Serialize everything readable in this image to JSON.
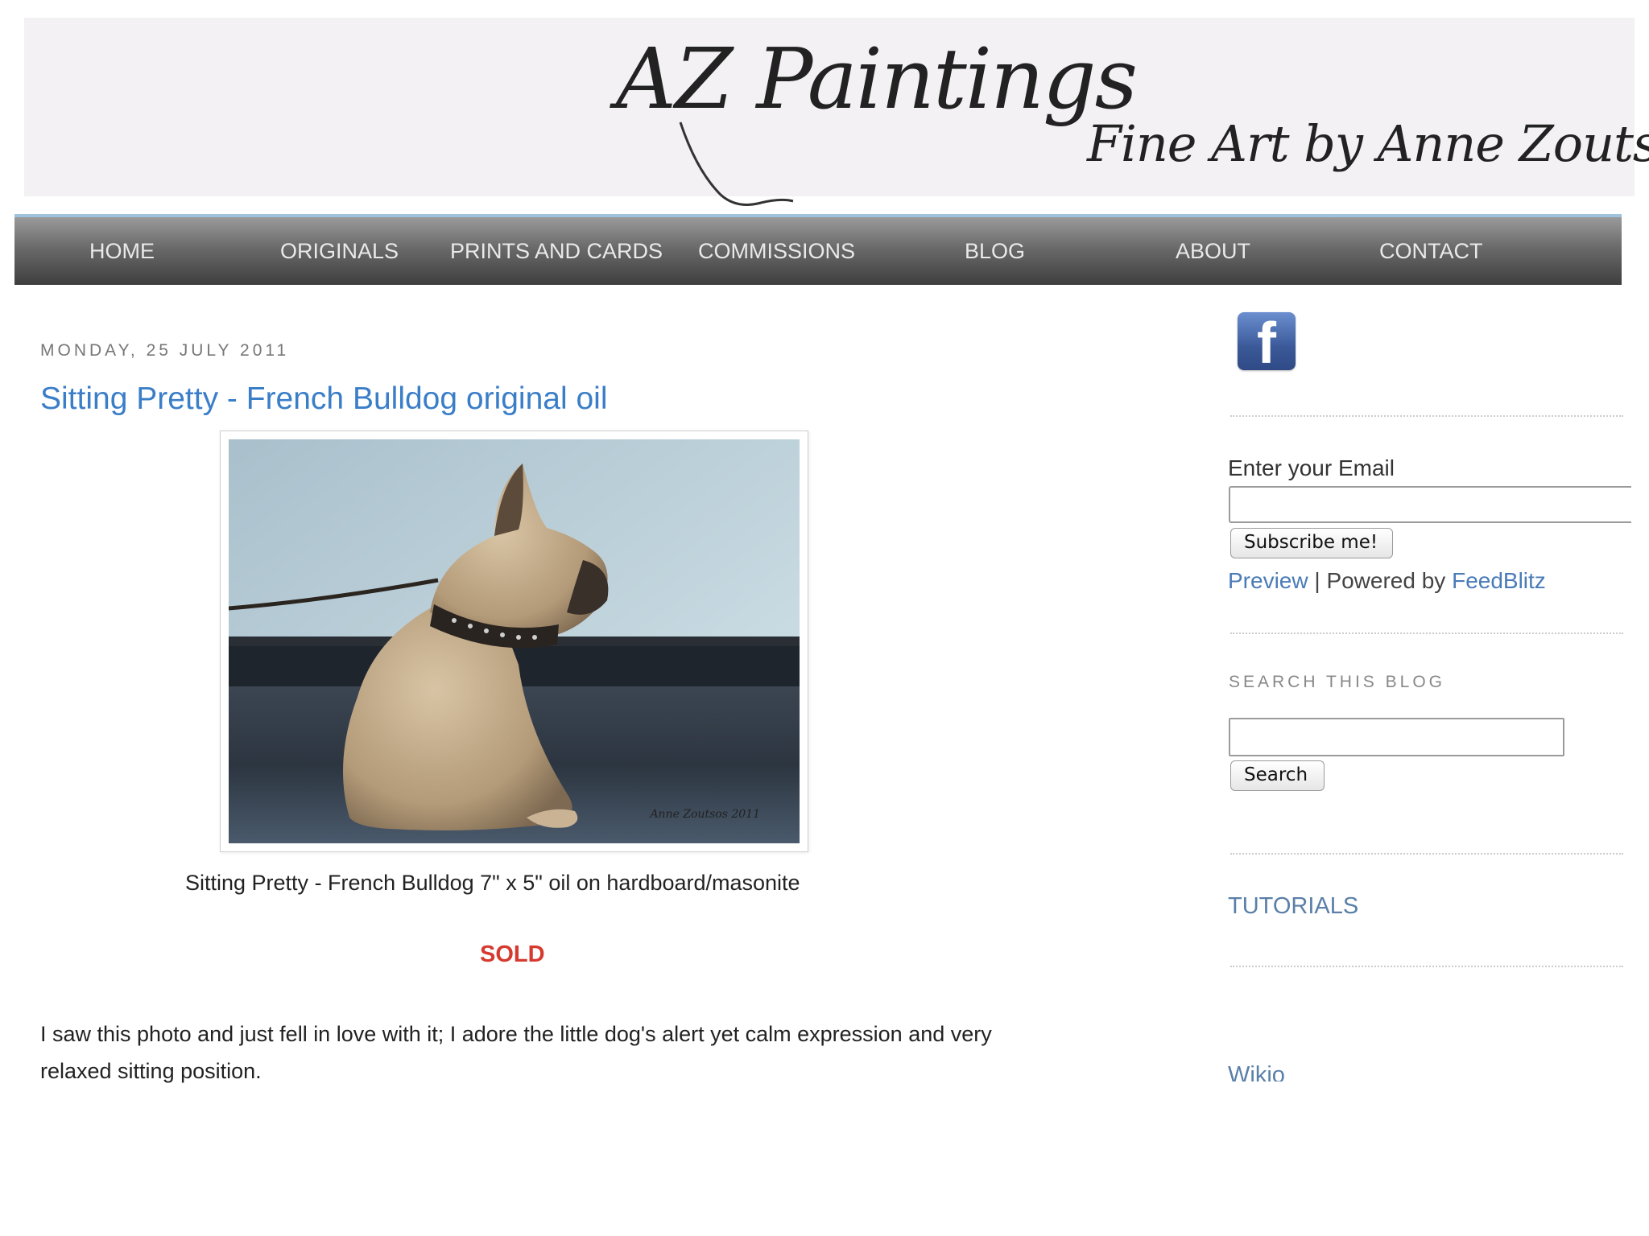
{
  "header": {
    "logo": "AZ Paintings",
    "tagline": "Fine Art by Anne Zoutsos"
  },
  "nav": {
    "items": [
      {
        "label": "HOME"
      },
      {
        "label": "ORIGINALS"
      },
      {
        "label": "PRINTS AND CARDS"
      },
      {
        "label": "COMMISSIONS"
      },
      {
        "label": "BLOG"
      },
      {
        "label": "ABOUT"
      },
      {
        "label": "CONTACT"
      }
    ]
  },
  "post": {
    "date": "MONDAY, 25 JULY 2011",
    "title": "Sitting Pretty - French Bulldog original oil",
    "caption": "Sitting Pretty - French Bulldog 7\" x 5\" oil on hardboard/masonite",
    "status": "SOLD",
    "body": "I saw this photo and just fell in love with it; I adore the little dog's alert yet calm expression and very relaxed sitting position."
  },
  "sidebar": {
    "facebook_icon": "facebook-icon",
    "subscribe": {
      "label": "Enter your Email",
      "button": "Subscribe me!",
      "preview_link": "Preview",
      "separator": "|",
      "powered_text": "Powered by",
      "feedblitz_link": "FeedBlitz"
    },
    "search": {
      "heading": "SEARCH THIS BLOG",
      "button": "Search"
    },
    "tutorials": "TUTORIALS",
    "wikio": "Wikio"
  },
  "colors": {
    "title_link": "#3b7ec8",
    "sold": "#d63a2f",
    "nav_top_border": "#9fc3dc",
    "sidebar_link": "#5a7fa8"
  }
}
